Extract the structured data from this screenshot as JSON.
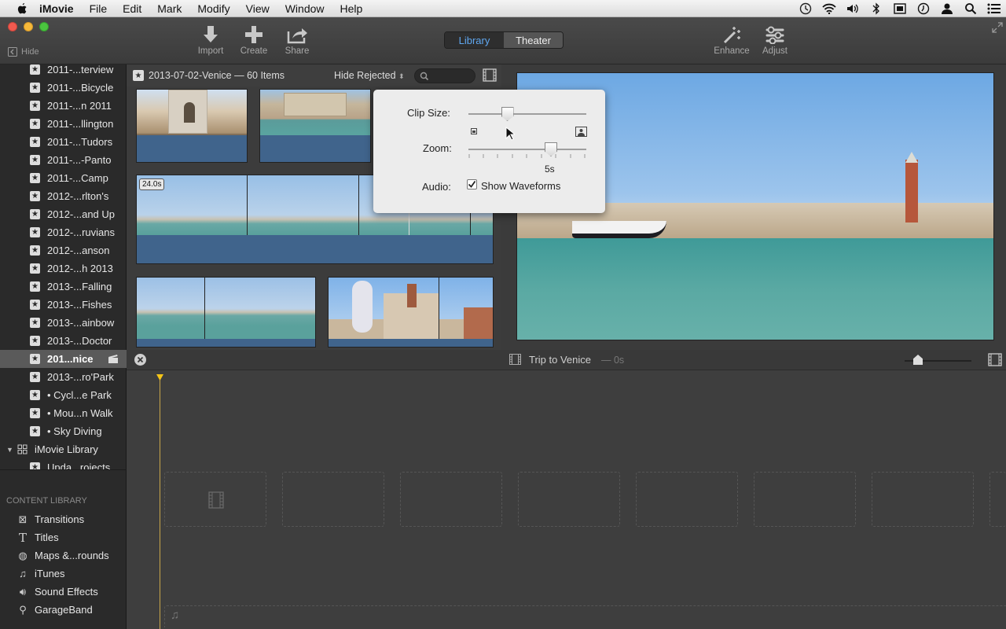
{
  "menubar": {
    "app_name": "iMovie",
    "menus": [
      "File",
      "Edit",
      "Mark",
      "Modify",
      "View",
      "Window",
      "Help"
    ]
  },
  "toolbar": {
    "hide_label": "Hide",
    "import_label": "Import",
    "create_label": "Create",
    "share_label": "Share",
    "library_tab": "Library",
    "theater_tab": "Theater",
    "enhance_label": "Enhance",
    "adjust_label": "Adjust"
  },
  "sidebar": {
    "events": [
      "2011-...terview",
      "2011-...Bicycle",
      "2011-...n 2011",
      "2011-...llington",
      "2011-...Tudors",
      "2011-...-Panto",
      "2011-...Camp",
      "2012-...rlton's",
      "2012-...and Up",
      "2012-...ruvians",
      "2012-...anson",
      "2012-...h 2013",
      "2013-...Falling",
      "2013-...Fishes",
      "2013-...ainbow",
      "2013-...Doctor",
      "201...nice",
      "2013-...ro'Park",
      "• Cycl...e Park",
      "• Mou...n Walk",
      "• Sky Diving"
    ],
    "library_label": "iMovie Library",
    "library_child": "Upda...rojects",
    "content_library_heading": "CONTENT LIBRARY",
    "content_items": [
      {
        "label": "Transitions",
        "icon": "transitions-icon"
      },
      {
        "label": "Titles",
        "icon": "titles-icon"
      },
      {
        "label": "Maps &...rounds",
        "icon": "maps-icon"
      },
      {
        "label": "iTunes",
        "icon": "itunes-icon"
      },
      {
        "label": "Sound Effects",
        "icon": "sound-effects-icon"
      },
      {
        "label": "GarageBand",
        "icon": "garageband-icon"
      }
    ]
  },
  "browser": {
    "title": "2013-07-02-Venice — 60 Items",
    "filter": "Hide Rejected",
    "clip_duration": "24.0s"
  },
  "popup": {
    "clip_size_label": "Clip Size:",
    "zoom_label": "Zoom:",
    "zoom_value": "5s",
    "audio_label": "Audio:",
    "waveforms_label": "Show Waveforms",
    "waveforms_checked": true,
    "clip_size_level": 0.33,
    "zoom_level": 0.7
  },
  "timeline": {
    "project_title": "Trip to Venice",
    "project_duration": "— 0s",
    "zoom_level": 0.2
  },
  "colors": {
    "accent": "#5fa7f0",
    "playhead": "#f5c518",
    "waveform": "#40648c"
  }
}
